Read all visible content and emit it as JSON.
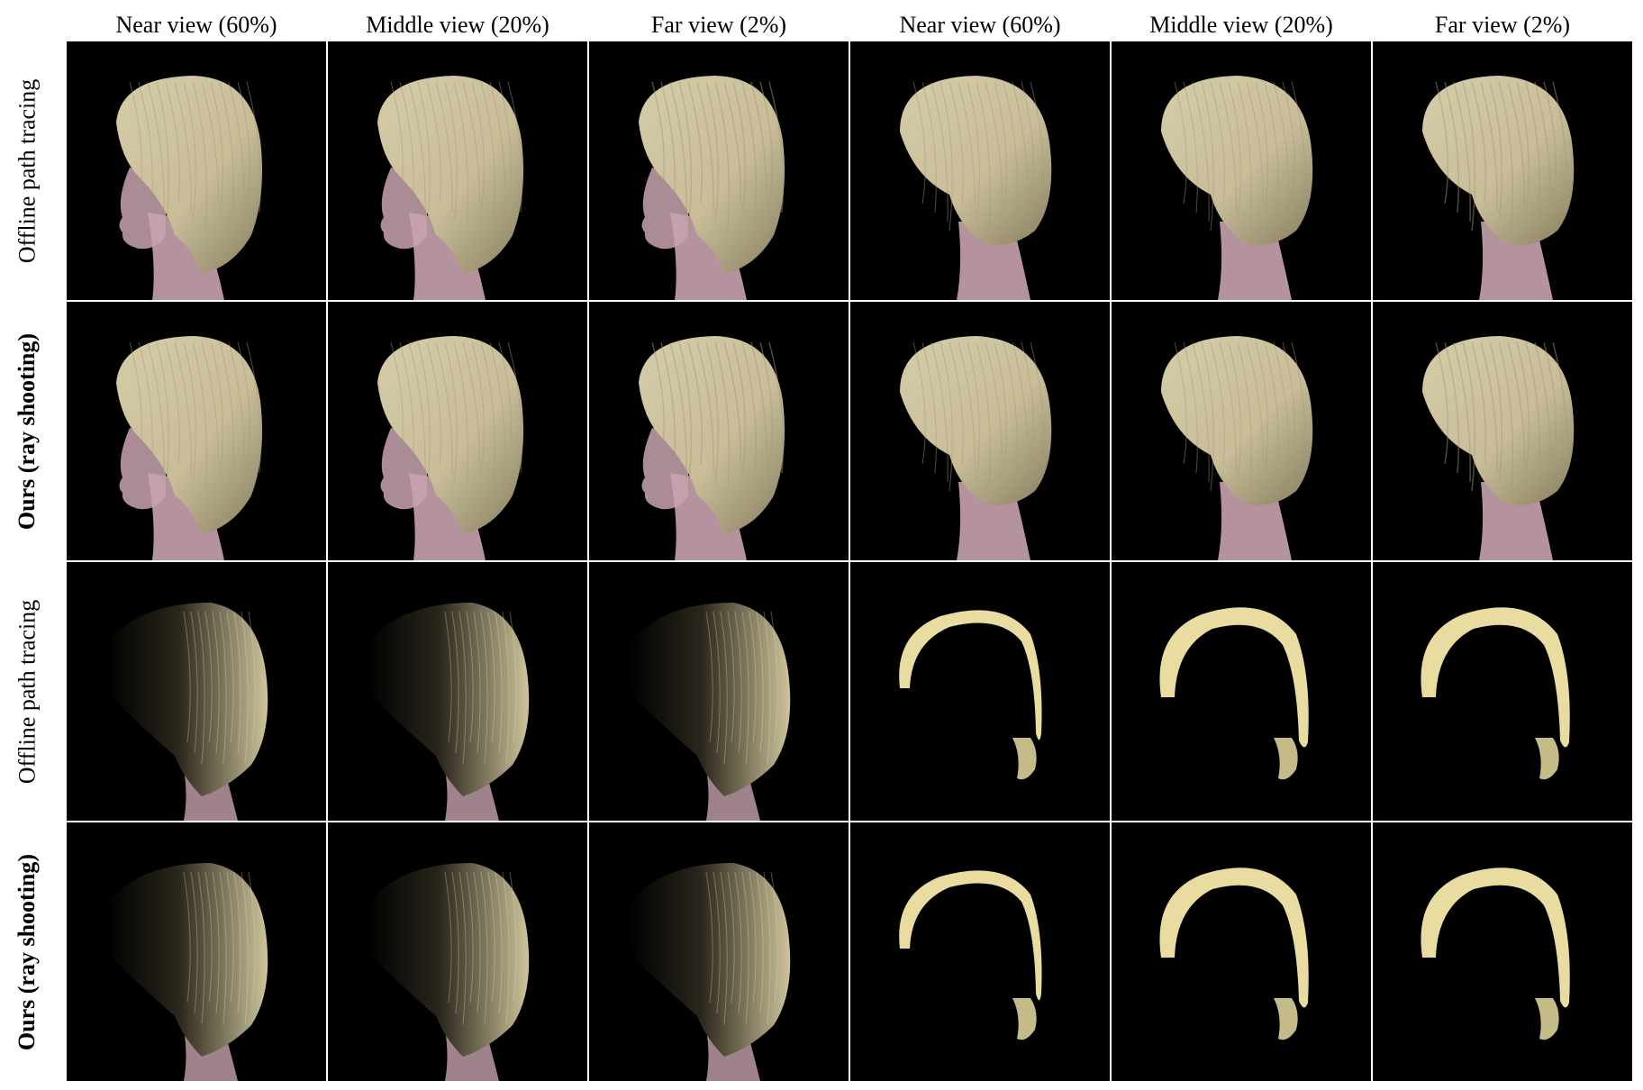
{
  "columns": [
    {
      "label": "Near view (60%)"
    },
    {
      "label": "Middle view (20%)"
    },
    {
      "label": "Far view (2%)"
    },
    {
      "label": "Near view (60%)"
    },
    {
      "label": "Middle view (20%)"
    },
    {
      "label": "Far view (2%)"
    }
  ],
  "rows": [
    {
      "label": "Offline path tracing",
      "bold": false,
      "lighting": "front",
      "icon": "hair-render-image"
    },
    {
      "label": "Ours (ray shooting)",
      "bold": true,
      "lighting": "front",
      "icon": "hair-render-image"
    },
    {
      "label": "Offline path tracing",
      "bold": false,
      "lighting": "back",
      "icon": "hair-render-image"
    },
    {
      "label": "Ours (ray shooting)",
      "bold": true,
      "lighting": "back",
      "icon": "hair-render-image"
    }
  ],
  "colors": {
    "background": "#000000",
    "hair_front": "#c8bd98",
    "hair_front_dark": "#8f8466",
    "hair_rim": "#e8dca0",
    "skin": "#c8a3b0",
    "grid_line": "#ffffff"
  }
}
